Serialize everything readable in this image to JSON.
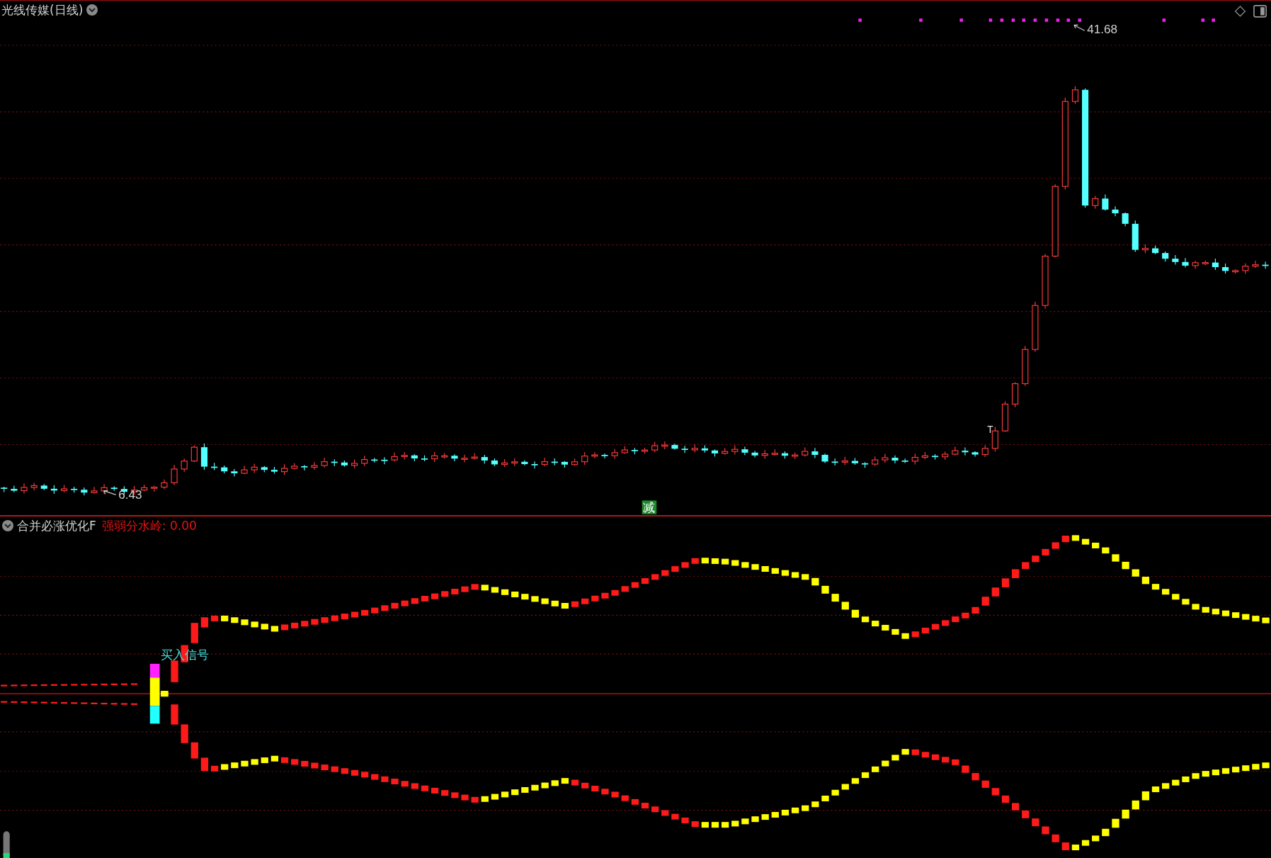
{
  "chart": {
    "title": "光线传媒(日线)",
    "high_label": "41.68",
    "low_label": "6.43",
    "marker": "T",
    "badge": "减"
  },
  "indicator": {
    "title": "合并必涨优化F",
    "reading": "强弱分水岭: 0.00",
    "signal_label": "买入信号"
  }
}
